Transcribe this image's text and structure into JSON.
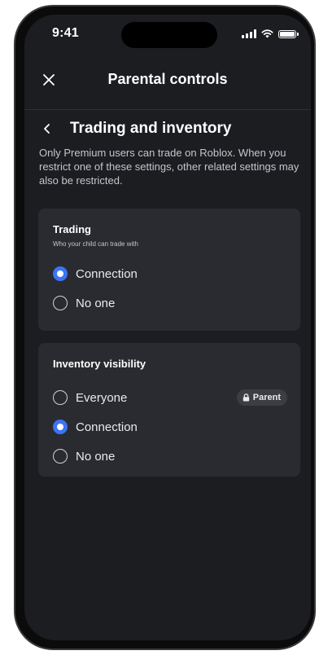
{
  "status_bar": {
    "time": "9:41"
  },
  "header": {
    "title": "Parental controls",
    "close_icon": "close-icon"
  },
  "section": {
    "title": "Trading and inventory",
    "back_icon": "chevron-left-icon",
    "description": "Only Premium users can trade on Roblox. When you restrict one of these settings, other related settings may also be restricted."
  },
  "trading": {
    "title": "Trading",
    "subtitle": "Who your child can trade with",
    "options": [
      {
        "label": "Connection",
        "selected": true
      },
      {
        "label": "No one",
        "selected": false
      }
    ]
  },
  "inventory": {
    "title": "Inventory visibility",
    "options": [
      {
        "label": "Everyone",
        "selected": false,
        "badge": "Parent",
        "badge_icon": "lock-icon"
      },
      {
        "label": "Connection",
        "selected": true
      },
      {
        "label": "No one",
        "selected": false
      }
    ]
  },
  "colors": {
    "background": "#1c1d21",
    "card": "#2a2b30",
    "accent": "#3d74f5",
    "text": "#e9eaed"
  }
}
